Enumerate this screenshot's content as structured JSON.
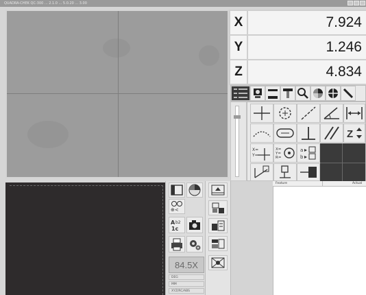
{
  "window": {
    "title": "QUADRA-CHEK QC-300 ... 2.1.0 ... 5.0.20 ... 3.00",
    "controls": [
      "minimize",
      "maximize",
      "close"
    ]
  },
  "dro": {
    "axes": [
      {
        "label": "X",
        "value": "7.924"
      },
      {
        "label": "Y",
        "value": "1.246"
      },
      {
        "label": "Z",
        "value": "4.834"
      }
    ]
  },
  "toolbar_top": {
    "icons": [
      "list-icon",
      "probe-icon",
      "edge-tool-icon",
      "display-icon",
      "zoom-icon",
      "color-icon",
      "crosshair-icon",
      "pen-icon"
    ]
  },
  "measure_tools": {
    "rows": [
      [
        "point-icon",
        "circle-icon",
        "line-icon",
        "angle-icon",
        "distance-icon"
      ],
      [
        "arc-icon",
        "slot-icon",
        "perpendicular-icon",
        "parallel-icon",
        "z-height-icon"
      ],
      [
        "xy-origin-icon",
        "xyr-icon",
        "ab-icon",
        "",
        ""
      ],
      [
        "skew-icon",
        "move-icon",
        "edge-probe-icon",
        "",
        ""
      ]
    ]
  },
  "bottom": {
    "zoom": "84.5X",
    "status": [
      "DEG",
      "MM",
      "XYZ/RC/ABS"
    ],
    "feature_panel": {
      "col1": "Feature",
      "col2": "Actual"
    }
  }
}
